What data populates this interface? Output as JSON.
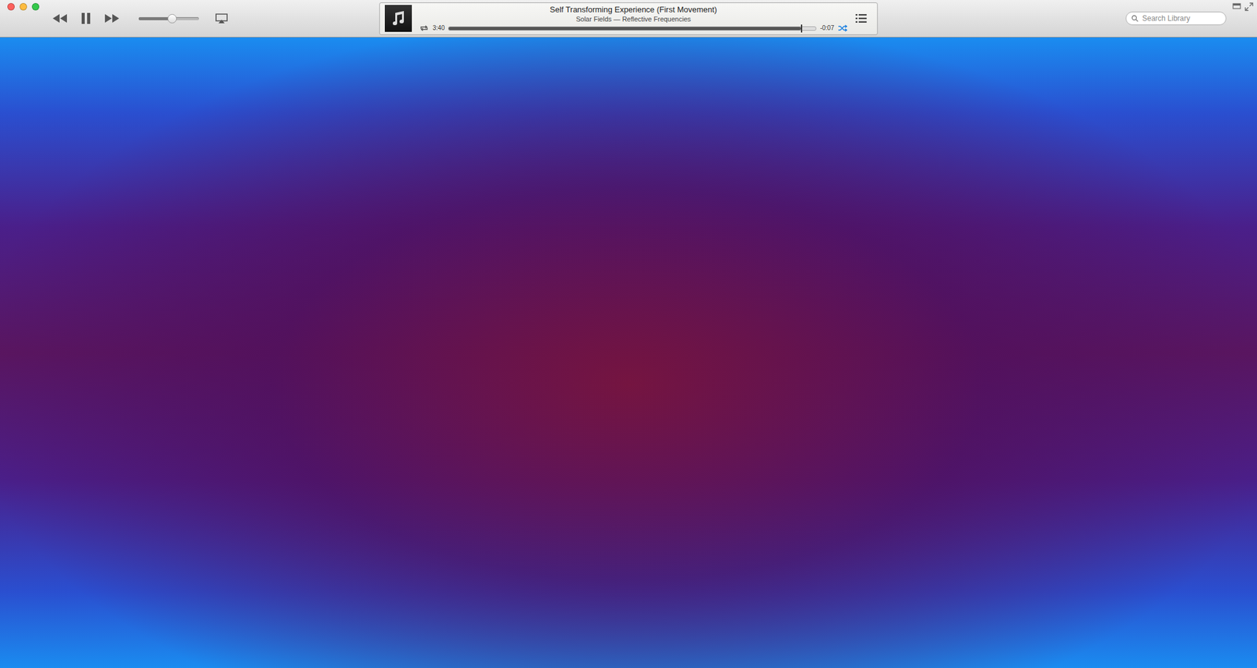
{
  "player": {
    "playing": true,
    "volume": {
      "level": 0.55
    },
    "now_playing": {
      "title": "Self Transforming Experience (First Movement)",
      "subtitle": "Solar Fields — Reflective Frequencies",
      "elapsed": "3:40",
      "remaining": "-0:07",
      "progress": {
        "level": 0.96
      },
      "repeat": false,
      "shuffle": true
    }
  },
  "search": {
    "placeholder": "Search Library"
  },
  "visualizer": {
    "shown": true
  }
}
